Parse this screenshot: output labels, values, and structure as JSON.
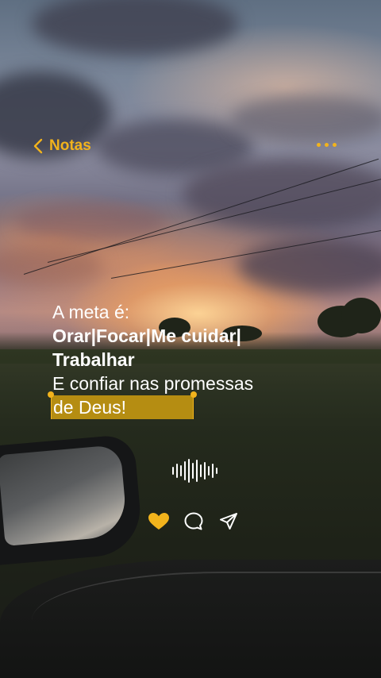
{
  "header": {
    "back_label": "Notas",
    "back_icon": "chevron-left-icon",
    "more_icon": "more-dots-icon"
  },
  "note": {
    "line1": "A meta é:",
    "line2": "Orar|Focar|Me cuidar|",
    "line3": "Trabalhar",
    "line4": "E confiar nas promessas",
    "line5_selected": "de Deus!"
  },
  "audio": {
    "icon": "waveform-icon"
  },
  "actions": {
    "like_icon": "heart-icon",
    "comment_icon": "comment-bubble-icon",
    "share_icon": "send-icon"
  },
  "colors": {
    "accent": "#f2b31c",
    "selection": "#b58d12",
    "text": "#ffffff"
  }
}
